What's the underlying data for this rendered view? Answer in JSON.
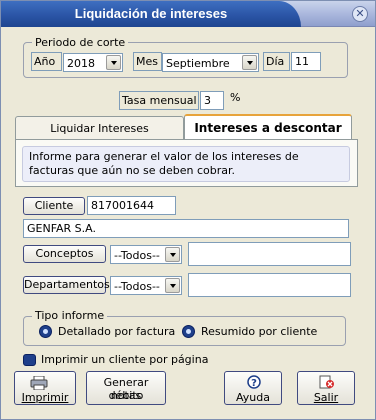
{
  "window": {
    "title": "Liquidación de intereses",
    "close_symbol": "✕"
  },
  "periodo": {
    "group_label": "Periodo de corte",
    "ano_label": "Año",
    "ano_value": "2018",
    "mes_label": "Mes",
    "mes_value": "Septiembre",
    "dia_label": "Día",
    "dia_value": "11"
  },
  "tasa": {
    "label": "Tasa mensual",
    "value": "3",
    "unit": "%"
  },
  "tabs": [
    {
      "label": "Liquidar Intereses"
    },
    {
      "label": "Intereses a descontar"
    }
  ],
  "tab_info": "Informe para generar el valor de los intereses de facturas que aún no se deben cobrar.",
  "cliente": {
    "button": "Cliente",
    "code": "817001644",
    "name": "GENFAR S.A."
  },
  "conceptos": {
    "button": "Conceptos",
    "selected": "--Todos--",
    "text": ""
  },
  "departamentos": {
    "button": "Departamentos",
    "selected": "--Todos--",
    "text": ""
  },
  "tipo_informe": {
    "group_label": "Tipo informe",
    "options": [
      "Detallado por factura",
      "Resumido por cliente"
    ],
    "selected": "Resumido por cliente"
  },
  "imprimir_cliente_label": "Imprimir un cliente por página",
  "actions": {
    "imprimir": "Imprimir",
    "generar_notas_line1": "Generar notas",
    "generar_notas_line2": "débito",
    "ayuda": "Ayuda",
    "salir": "Salir"
  },
  "colors": {
    "title_blue": "#2b55a6",
    "window_bg": "#ece9d8",
    "tab_accent": "#e7a33b",
    "radio_blue": "#1e3f8a"
  }
}
